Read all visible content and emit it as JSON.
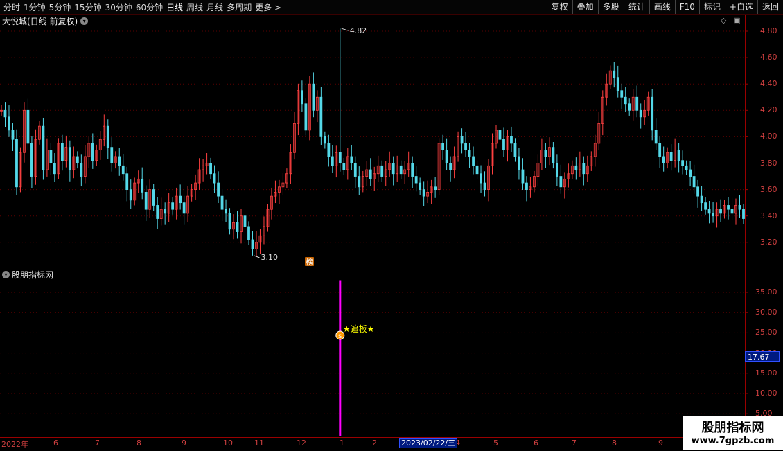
{
  "toolbar": {
    "periods": [
      "分时",
      "1分钟",
      "5分钟",
      "15分钟",
      "30分钟",
      "60分钟",
      "日线",
      "周线",
      "月线",
      "多周期",
      "更多 >"
    ],
    "active_period": "日线",
    "right_buttons": [
      "复权",
      "叠加",
      "多股",
      "统计",
      "画线",
      "F10",
      "标记",
      "+自选",
      "返回"
    ]
  },
  "chart": {
    "title": "大悦城(日线 前复权)",
    "high_label": "4.82",
    "low_label": "3.10",
    "bang_label": "榜",
    "price_axis": [
      "4.80",
      "4.60",
      "4.40",
      "4.20",
      "4.00",
      "3.80",
      "3.60",
      "3.40",
      "3.20"
    ]
  },
  "indicator": {
    "title": "股朋指标网",
    "signal_label": "★追板★",
    "axis": [
      "35.00",
      "30.00",
      "25.00",
      "20.00",
      "15.00",
      "10.00",
      "5.00"
    ],
    "current_value": "17.67"
  },
  "date_axis": {
    "labels": [
      "2022年",
      "6",
      "7",
      "8",
      "9",
      "10",
      "11",
      "12",
      "1",
      "2",
      "3",
      "4",
      "5",
      "6",
      "7",
      "8",
      "9"
    ],
    "highlight": "2023/02/22/三"
  },
  "watermark": {
    "line1": "股朋指标网",
    "line2": "www.7gpzb.com"
  },
  "colors": {
    "up": "#ff4040",
    "down": "#54d8e8",
    "axis": "#d24040",
    "signal": "#ff00ff",
    "accent": "#ffff00"
  },
  "chart_data": {
    "type": "candlestick",
    "ylim": [
      3.05,
      4.88
    ],
    "closes": [
      4.2,
      4.15,
      4.05,
      3.98,
      3.62,
      3.88,
      4.2,
      3.95,
      3.7,
      3.98,
      4.08,
      3.75,
      3.9,
      3.8,
      3.72,
      3.95,
      3.82,
      3.92,
      3.75,
      3.85,
      3.8,
      3.7,
      3.85,
      3.95,
      3.82,
      3.9,
      3.98,
      4.08,
      3.92,
      3.8,
      3.85,
      3.78,
      3.72,
      3.6,
      3.52,
      3.65,
      3.68,
      3.58,
      3.45,
      3.6,
      3.48,
      3.38,
      3.45,
      3.42,
      3.5,
      3.45,
      3.55,
      3.5,
      3.42,
      3.55,
      3.6,
      3.65,
      3.75,
      3.78,
      3.8,
      3.72,
      3.65,
      3.55,
      3.45,
      3.42,
      3.3,
      3.35,
      3.28,
      3.4,
      3.32,
      3.22,
      3.15,
      3.2,
      3.25,
      3.32,
      3.45,
      3.55,
      3.58,
      3.62,
      3.65,
      3.72,
      3.88,
      4.1,
      4.35,
      4.25,
      4.05,
      4.4,
      4.2,
      4.3,
      4.0,
      3.95,
      3.85,
      3.78,
      3.88,
      3.8,
      3.75,
      3.85,
      3.8,
      3.7,
      3.62,
      3.7,
      3.75,
      3.68,
      3.72,
      3.78,
      3.7,
      3.75,
      3.8,
      3.72,
      3.78,
      3.72,
      3.75,
      3.8,
      3.7,
      3.65,
      3.6,
      3.55,
      3.58,
      3.62,
      3.6,
      3.95,
      3.9,
      3.8,
      3.75,
      3.85,
      4.0,
      3.95,
      3.9,
      3.85,
      3.78,
      3.72,
      3.65,
      3.6,
      3.78,
      3.95,
      4.05,
      3.98,
      3.9,
      4.0,
      3.95,
      3.85,
      3.75,
      3.65,
      3.6,
      3.62,
      3.7,
      3.8,
      3.9,
      3.85,
      3.92,
      3.8,
      3.7,
      3.62,
      3.68,
      3.72,
      3.78,
      3.75,
      3.8,
      3.72,
      3.78,
      3.85,
      3.95,
      4.1,
      4.3,
      4.4,
      4.5,
      4.45,
      4.35,
      4.3,
      4.25,
      4.2,
      4.3,
      4.2,
      4.15,
      4.2,
      4.3,
      4.05,
      3.95,
      3.85,
      3.8,
      3.88,
      3.82,
      3.9,
      3.82,
      3.78,
      3.75,
      3.7,
      3.62,
      3.55,
      3.5,
      3.45,
      3.42,
      3.4,
      3.45,
      3.42,
      3.48,
      3.45,
      3.42,
      3.48,
      3.45,
      3.38
    ]
  },
  "indicator_data": {
    "type": "bar",
    "ylim": [
      3.5,
      40
    ],
    "index": 89,
    "value": 38
  }
}
